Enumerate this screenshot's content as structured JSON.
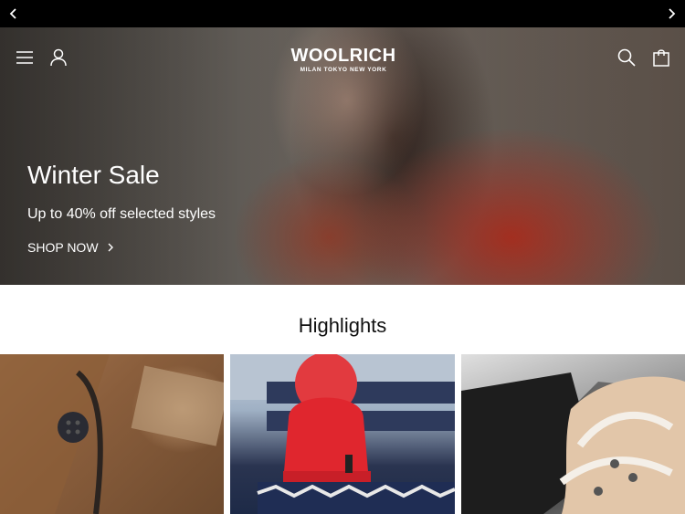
{
  "topbar": {
    "prev_icon": "chevron-left-icon",
    "next_icon": "chevron-right-icon"
  },
  "header": {
    "menu_icon": "hamburger-menu-icon",
    "account_icon": "user-icon",
    "search_icon": "search-icon",
    "cart_icon": "shopping-bag-icon",
    "logo": {
      "brand": "WOOLRICH",
      "cities": "MILAN TOKYO NEW YORK"
    }
  },
  "hero": {
    "title": "Winter Sale",
    "subtitle": "Up to 40% off selected styles",
    "cta_label": "SHOP NOW",
    "cta_icon": "chevron-right-icon"
  },
  "highlights": {
    "title": "Highlights"
  },
  "colors": {
    "topbar": "#000000",
    "text_on_hero": "#ffffff",
    "hero_red": "#a82e1e"
  }
}
